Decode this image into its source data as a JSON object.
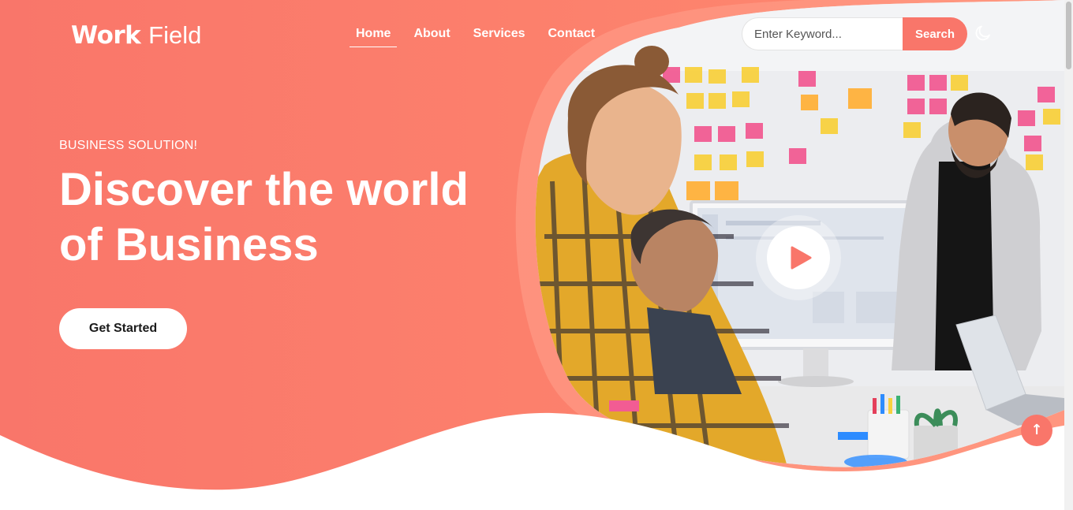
{
  "brand": {
    "name_bold": "Work",
    "name_light": "Field"
  },
  "nav": {
    "items": [
      "Home",
      "About",
      "Services",
      "Contact"
    ],
    "active": "Home"
  },
  "search": {
    "placeholder": "Enter Keyword...",
    "button_label": "Search"
  },
  "theme_toggle_icon": "moon-icon",
  "hero": {
    "eyebrow": "BUSINESS SOLUTION!",
    "headline_line1": "Discover the world",
    "headline_line2": "of Business",
    "cta_label": "Get Started"
  },
  "media": {
    "play_icon": "play-icon"
  },
  "scroll_top_icon": "arrow-up-icon",
  "colors": {
    "accent": "#f9766a",
    "accent_gradient_end": "#fe8c6e",
    "text_on_accent": "#ffffff"
  }
}
